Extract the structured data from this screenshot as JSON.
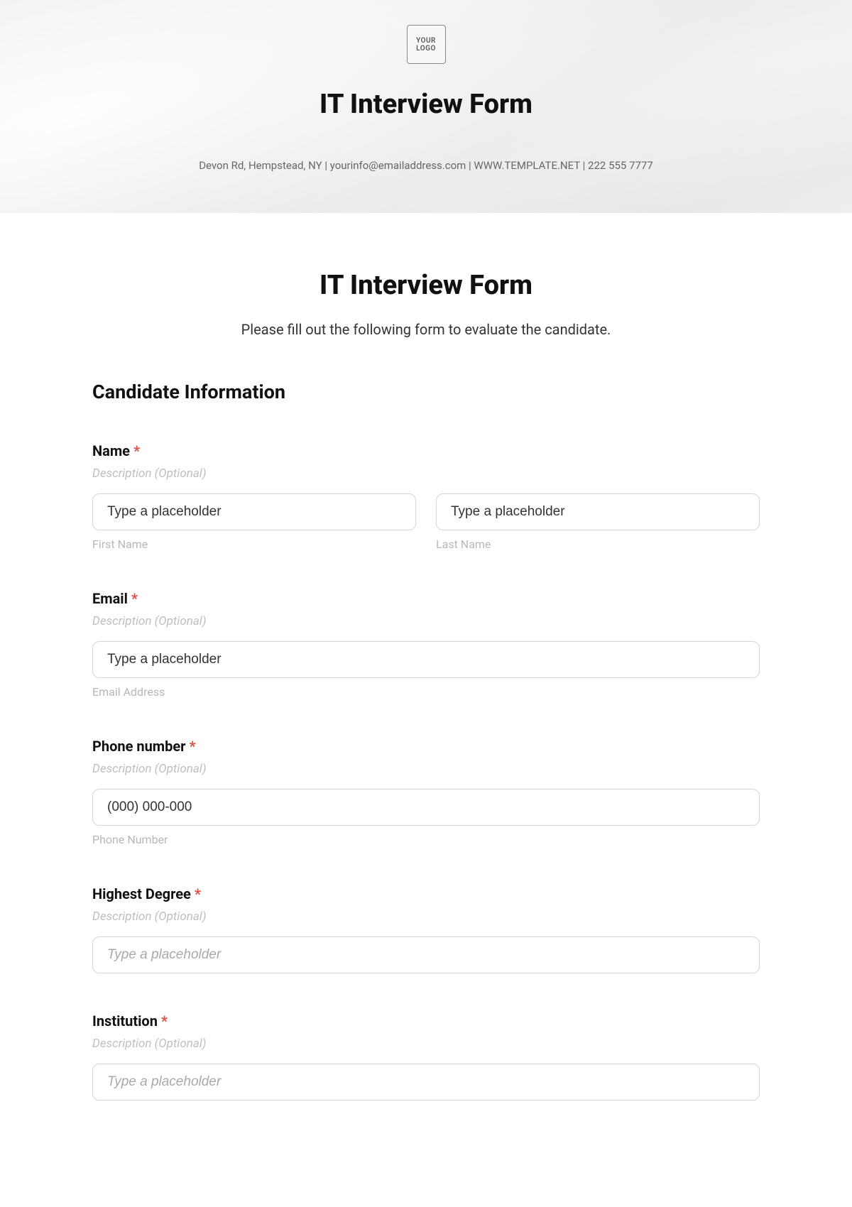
{
  "hero": {
    "logo_text": "YOUR\nLOGO",
    "title": "IT Interview Form",
    "contact_line": "Devon Rd, Hempstead, NY | yourinfo@emailaddress.com | WWW.TEMPLATE.NET | 222 555 7777"
  },
  "main": {
    "title": "IT Interview Form",
    "subtitle": "Please fill out the following form to evaluate the candidate."
  },
  "section": {
    "candidate_info": "Candidate Information"
  },
  "fields": {
    "name": {
      "label": "Name",
      "required_mark": "*",
      "description": "Description (Optional)",
      "first_placeholder": "Type a placeholder",
      "first_sublabel": "First Name",
      "last_placeholder": "Type a placeholder",
      "last_sublabel": "Last Name"
    },
    "email": {
      "label": "Email",
      "required_mark": "*",
      "description": "Description (Optional)",
      "placeholder": "Type a placeholder",
      "sublabel": "Email Address"
    },
    "phone": {
      "label": "Phone number",
      "required_mark": "*",
      "description": "Description (Optional)",
      "placeholder": "(000) 000-000",
      "sublabel": "Phone Number"
    },
    "degree": {
      "label": "Highest Degree",
      "required_mark": "*",
      "description": "Description (Optional)",
      "placeholder": "Type a placeholder"
    },
    "institution": {
      "label": "Institution",
      "required_mark": "*",
      "description": "Description (Optional)",
      "placeholder": "Type a placeholder"
    }
  }
}
